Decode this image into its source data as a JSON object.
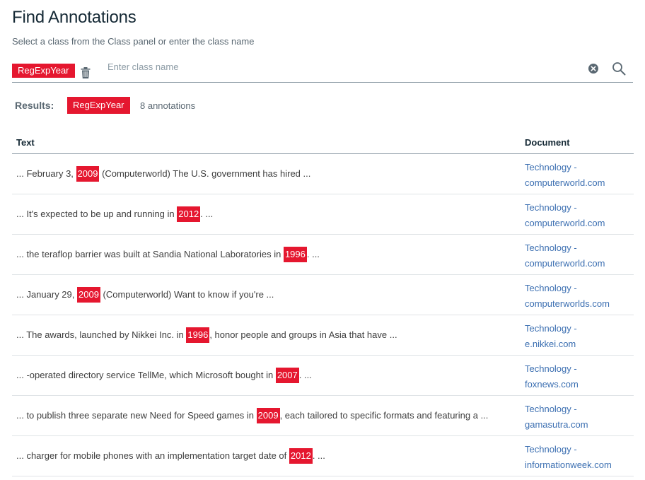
{
  "header": {
    "title": "Find Annotations",
    "subtitle": "Select a class from the Class panel or enter the class name"
  },
  "search": {
    "selected_tag": "RegExpYear",
    "placeholder": "Enter class name",
    "value": ""
  },
  "results": {
    "label": "Results:",
    "class_tag": "RegExpYear",
    "count_text": "8 annotations"
  },
  "table": {
    "columns": [
      "Text",
      "Document"
    ],
    "rows": [
      {
        "before": "... February 3, ",
        "match": "2009",
        "after": " (Computerworld) The U.S. government has hired ...",
        "doc_line1": "Technology -",
        "doc_line2": "computerworld.com"
      },
      {
        "before": "... It's expected to be up and running in ",
        "match": "2012",
        "after": ". ...",
        "doc_line1": "Technology -",
        "doc_line2": "computerworld.com"
      },
      {
        "before": "... the teraflop barrier was built at Sandia National Laboratories in ",
        "match": "1996",
        "after": ". ...",
        "doc_line1": "Technology -",
        "doc_line2": "computerworld.com"
      },
      {
        "before": "... January 29, ",
        "match": "2009",
        "after": " (Computerworld) Want to know if you're ...",
        "doc_line1": "Technology -",
        "doc_line2": "computerworlds.com"
      },
      {
        "before": "... The awards, launched by Nikkei Inc. in ",
        "match": "1996",
        "after": ", honor people and groups in Asia that have ...",
        "doc_line1": "Technology -",
        "doc_line2": "e.nikkei.com"
      },
      {
        "before": "... -operated directory service TellMe, which Microsoft bought in ",
        "match": "2007",
        "after": ". ...",
        "doc_line1": "Technology -",
        "doc_line2": "foxnews.com"
      },
      {
        "before": "... to publish three separate new Need for Speed games in ",
        "match": "2009",
        "after": ", each tailored to specific formats and featuring a ...",
        "doc_line1": "Technology -",
        "doc_line2": "gamasutra.com"
      },
      {
        "before": "... charger for mobile phones with an implementation target date of ",
        "match": "2012",
        "after": ". ...",
        "doc_line1": "Technology -",
        "doc_line2": "informationweek.com"
      }
    ]
  },
  "icons": {
    "delete": "trash-icon",
    "clear": "clear-icon",
    "search": "search-icon"
  },
  "colors": {
    "tag_red": "#e5172f",
    "link_blue": "#3d70b2",
    "title": "#152935"
  }
}
